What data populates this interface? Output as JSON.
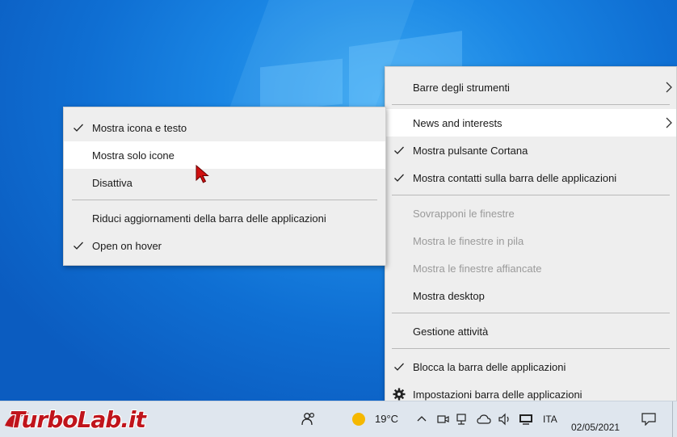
{
  "context_menu": {
    "items": [
      {
        "label": "Barre degli strumenti"
      },
      {
        "label": "News and interests"
      },
      {
        "label": "Mostra pulsante Cortana"
      },
      {
        "label": "Mostra contatti sulla barra delle applicazioni"
      },
      {
        "label": "Sovrapponi le finestre"
      },
      {
        "label": "Mostra le finestre in pila"
      },
      {
        "label": "Mostra le finestre affiancate"
      },
      {
        "label": "Mostra desktop"
      },
      {
        "label": "Gestione attività"
      },
      {
        "label": "Blocca la barra delle applicazioni"
      },
      {
        "label": "Impostazioni barra delle applicazioni"
      }
    ]
  },
  "submenu": {
    "items": [
      {
        "label": "Mostra icona e testo"
      },
      {
        "label": "Mostra solo icone"
      },
      {
        "label": "Disattiva"
      },
      {
        "label": "Riduci aggiornamenti della barra delle applicazioni"
      },
      {
        "label": "Open on hover"
      }
    ]
  },
  "taskbar": {
    "logo_text": "TurboLab.it",
    "weather_temp": "19°C",
    "language": "ITA",
    "date": "02/05/2021"
  },
  "colors": {
    "desktop": "#1a86e4",
    "menu_bg": "#eeeeee",
    "hover_bg": "#ffffff",
    "disabled_text": "#9a9a9a",
    "cursor": "#d01010"
  }
}
